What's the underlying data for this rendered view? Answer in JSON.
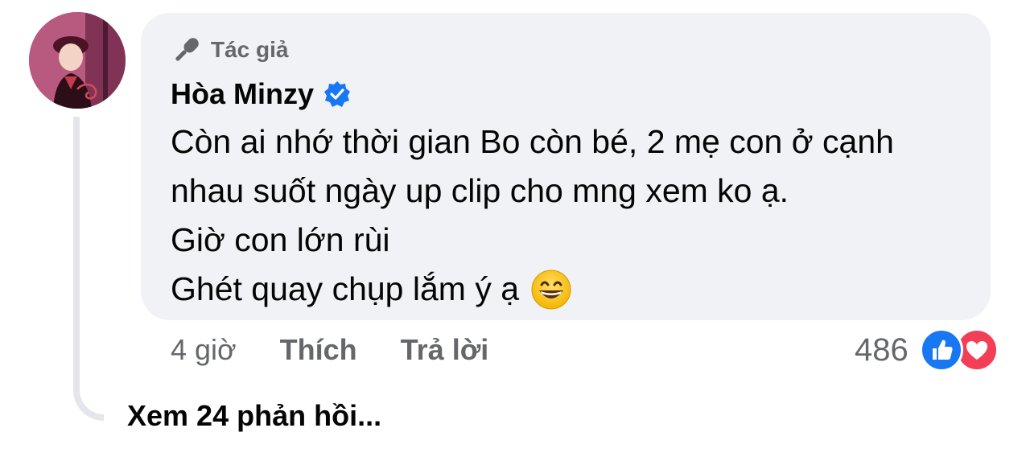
{
  "comment": {
    "author_badge": "Tác giả",
    "author_name": "Hòa Minzy",
    "text_lines": [
      "Còn ai nhớ thời gian Bo còn bé, 2 mẹ con ở cạnh",
      "nhau suốt ngày up clip cho mng xem ko ạ.",
      "Giờ con lớn rùi",
      "Ghét quay chụp lắm ý ạ"
    ],
    "timestamp": "4 giờ",
    "like_label": "Thích",
    "reply_label": "Trả lời",
    "reaction_count": "486",
    "reaction_icons": [
      "like-icon",
      "love-icon"
    ],
    "emoji": "grinning-face-emoji"
  },
  "replies": {
    "see_more_label": "Xem 24 phản hồi..."
  },
  "colors": {
    "bubble_bg": "#f0f2f5",
    "secondary_text": "#65676b",
    "like_blue": "#1877f2",
    "love_red": "#f33e58",
    "thread_line": "#e4e6eb"
  }
}
